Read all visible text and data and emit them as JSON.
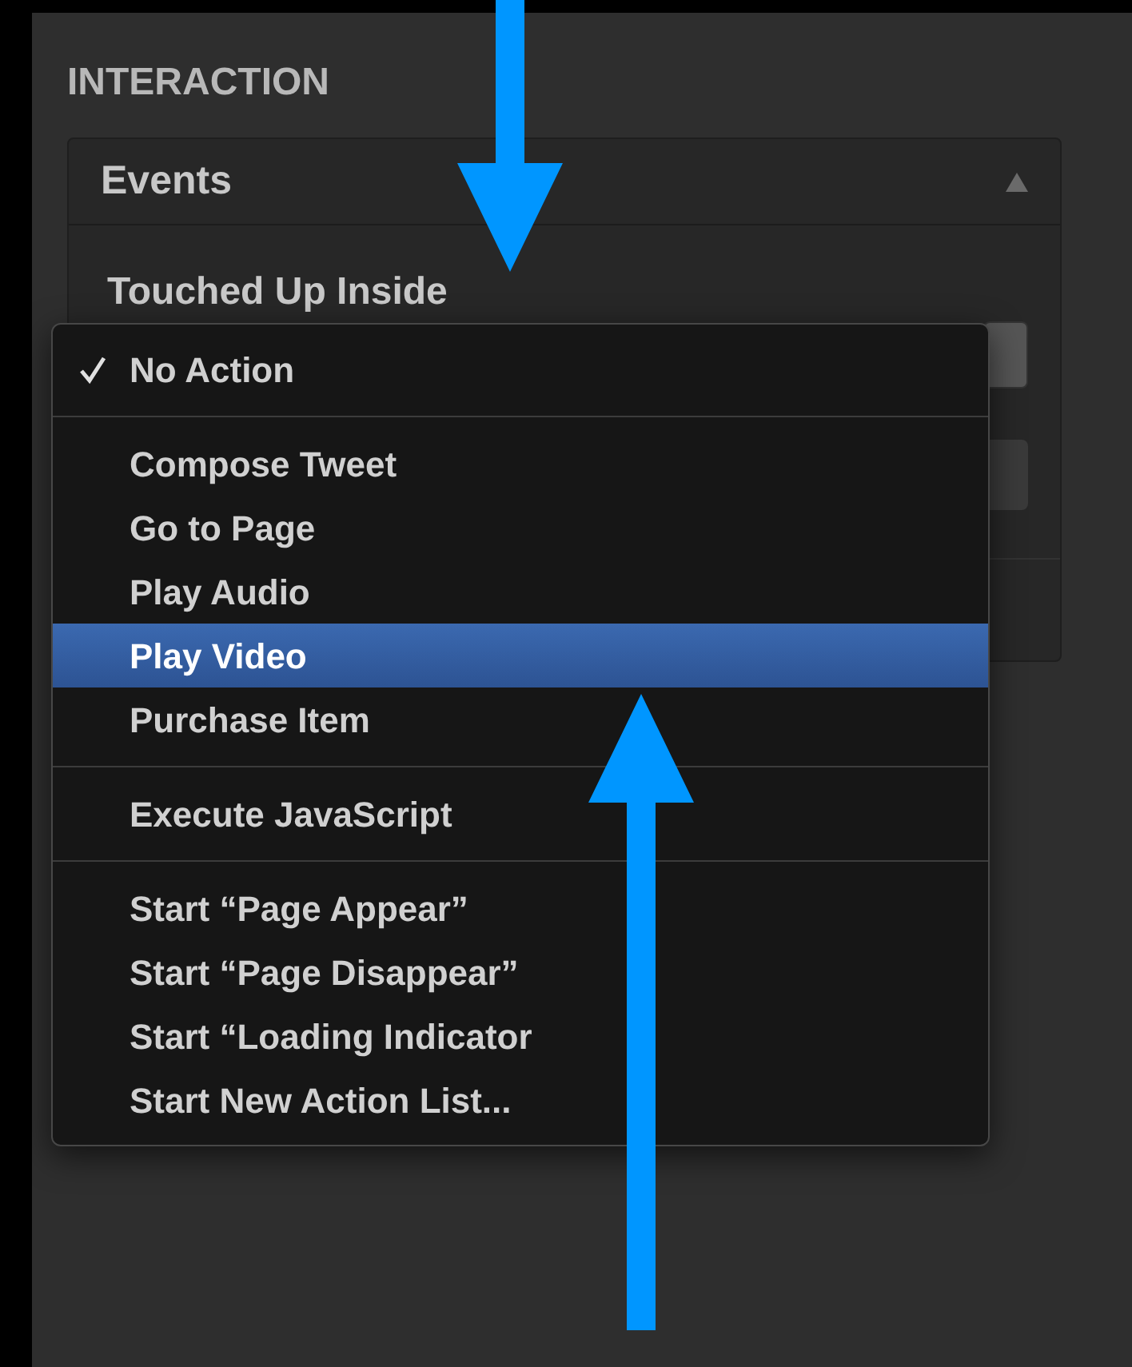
{
  "section_title": "INTERACTION",
  "card": {
    "title": "Events",
    "expanded": true,
    "event_label": "Touched Up Inside"
  },
  "menu": [
    {
      "kind": "item",
      "label": "No Action",
      "checked": true,
      "selected": false
    },
    {
      "kind": "separator"
    },
    {
      "kind": "item",
      "label": "Compose Tweet",
      "checked": false,
      "selected": false
    },
    {
      "kind": "item",
      "label": "Go to Page",
      "checked": false,
      "selected": false
    },
    {
      "kind": "item",
      "label": "Play Audio",
      "checked": false,
      "selected": false
    },
    {
      "kind": "item",
      "label": "Play Video",
      "checked": false,
      "selected": true
    },
    {
      "kind": "item",
      "label": "Purchase Item",
      "checked": false,
      "selected": false
    },
    {
      "kind": "separator"
    },
    {
      "kind": "item",
      "label": "Execute JavaScript",
      "checked": false,
      "selected": false
    },
    {
      "kind": "separator"
    },
    {
      "kind": "item",
      "label": "Start “Page Appear”",
      "checked": false,
      "selected": false
    },
    {
      "kind": "item",
      "label": "Start “Page Disappear”",
      "checked": false,
      "selected": false
    },
    {
      "kind": "item",
      "label": "Start “Loading Indicator",
      "checked": false,
      "selected": false
    },
    {
      "kind": "item",
      "label": "Start New Action List...",
      "checked": false,
      "selected": false
    }
  ]
}
